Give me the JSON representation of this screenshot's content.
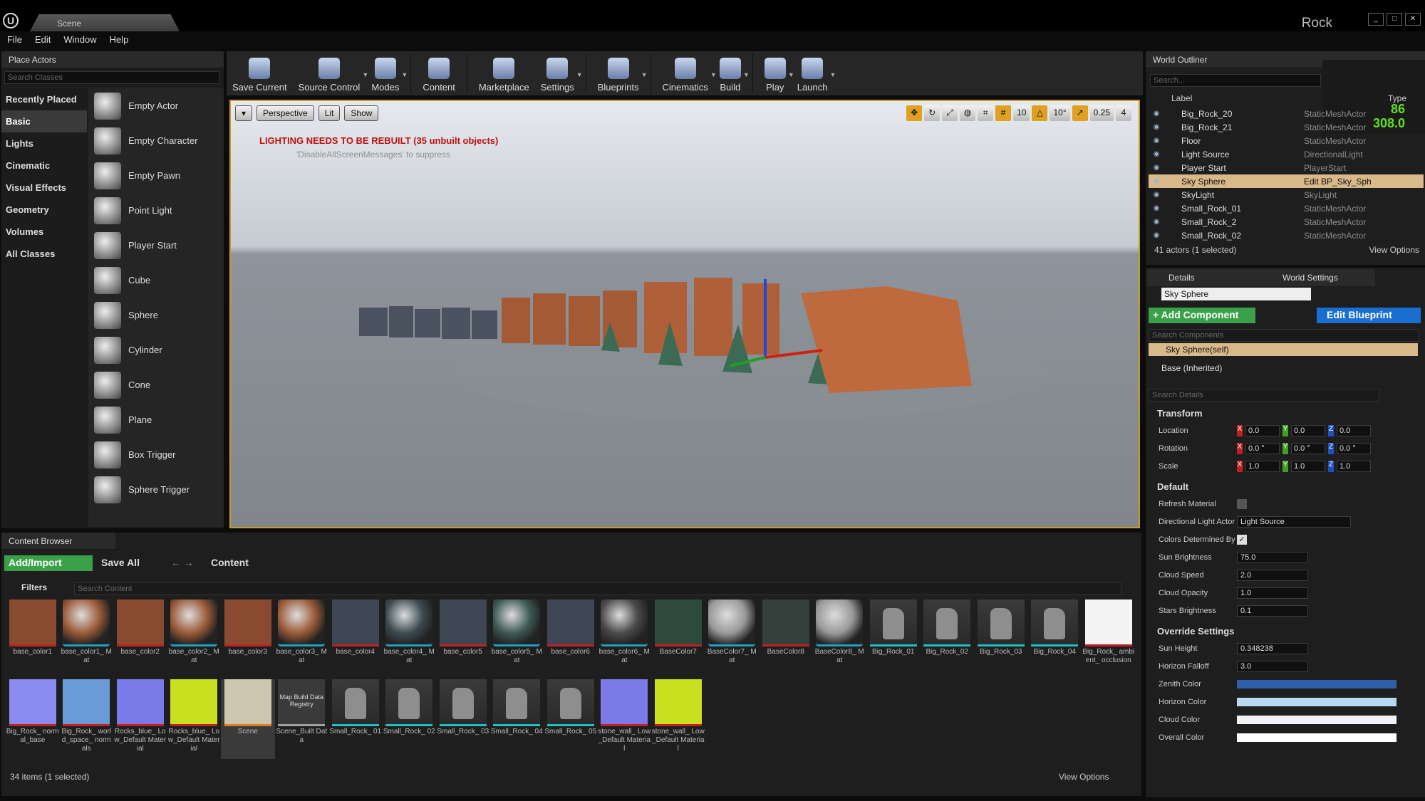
{
  "window": {
    "tab_title": "Scene",
    "project": "Rock"
  },
  "menu": [
    "File",
    "Edit",
    "Window",
    "Help"
  ],
  "place_actors": {
    "title": "Place Actors",
    "search_placeholder": "Search Classes",
    "categories": [
      "Recently Placed",
      "Basic",
      "Lights",
      "Cinematic",
      "Visual Effects",
      "Geometry",
      "Volumes",
      "All Classes"
    ],
    "selected_category": "Basic",
    "actors": [
      "Empty Actor",
      "Empty Character",
      "Empty Pawn",
      "Point Light",
      "Player Start",
      "Cube",
      "Sphere",
      "Cylinder",
      "Cone",
      "Plane",
      "Box Trigger",
      "Sphere Trigger"
    ]
  },
  "toolbar": [
    {
      "label": "Save Current",
      "dd": false
    },
    {
      "label": "Source Control",
      "dd": true
    },
    {
      "label": "Modes",
      "dd": true
    },
    {
      "label": "Content",
      "dd": false
    },
    {
      "label": "Marketplace",
      "dd": false
    },
    {
      "label": "Settings",
      "dd": true
    },
    {
      "label": "Blueprints",
      "dd": true
    },
    {
      "label": "Cinematics",
      "dd": true
    },
    {
      "label": "Build",
      "dd": true
    },
    {
      "label": "Play",
      "dd": true
    },
    {
      "label": "Launch",
      "dd": true
    }
  ],
  "viewport": {
    "view_mode": "Perspective",
    "lit": "Lit",
    "show": "Show",
    "grid": "10",
    "rot": "10°",
    "scale": "0.25",
    "cam_speed": "4",
    "warning": "LIGHTING NEEDS TO BE REBUILT (35 unbuilt objects)",
    "hint": "'DisableAllScreenMessages' to suppress"
  },
  "outliner": {
    "title": "World Outliner",
    "search_placeholder": "Search...",
    "col_label": "Label",
    "col_type": "Type",
    "stat_fps": "86",
    "stat_ms": "308.0",
    "rows": [
      {
        "label": "Big_Rock_20",
        "type": "StaticMeshActor"
      },
      {
        "label": "Big_Rock_21",
        "type": "StaticMeshActor"
      },
      {
        "label": "Floor",
        "type": "StaticMeshActor"
      },
      {
        "label": "Light Source",
        "type": "DirectionalLight"
      },
      {
        "label": "Player Start",
        "type": "PlayerStart"
      },
      {
        "label": "Sky Sphere",
        "type": "Edit BP_Sky_Sph"
      },
      {
        "label": "SkyLight",
        "type": "SkyLight"
      },
      {
        "label": "Small_Rock_01",
        "type": "StaticMeshActor"
      },
      {
        "label": "Small_Rock_2",
        "type": "StaticMeshActor"
      },
      {
        "label": "Small_Rock_02",
        "type": "StaticMeshActor"
      }
    ],
    "selected": "Sky Sphere",
    "footer": "41 actors (1 selected)",
    "view_options": "View Options"
  },
  "details": {
    "tab_details": "Details",
    "tab_world": "World Settings",
    "name": "Sky Sphere",
    "add_component": "+ Add Component",
    "edit_blueprint": "Edit Blueprint",
    "search_components": "Search Components",
    "comp_self": "Sky Sphere(self)",
    "comp_base": "Base (Inherited)",
    "search_details": "Search Details",
    "transform": "Transform",
    "location": {
      "label": "Location",
      "x": "0.0",
      "y": "0.0",
      "z": "0.0"
    },
    "rotation": {
      "label": "Rotation",
      "x": "0.0 °",
      "y": "0.0 °",
      "z": "0.0 °"
    },
    "scale": {
      "label": "Scale",
      "x": "1.0",
      "y": "1.0",
      "z": "1.0"
    },
    "default": "Default",
    "refresh_material": "Refresh Material",
    "dir_light_actor": "Directional Light Actor",
    "dir_light_value": "Light Source",
    "colors_determined": "Colors Determined By",
    "sun_brightness": {
      "label": "Sun Brightness",
      "value": "75.0"
    },
    "cloud_speed": {
      "label": "Cloud Speed",
      "value": "2.0"
    },
    "cloud_opacity": {
      "label": "Cloud Opacity",
      "value": "1.0"
    },
    "stars_brightness": {
      "label": "Stars Brightness",
      "value": "0.1"
    },
    "override": "Override Settings",
    "sun_height": {
      "label": "Sun Height",
      "value": "0.348238"
    },
    "horizon_falloff": {
      "label": "Horizon Falloff",
      "value": "3.0"
    },
    "zenith_color": {
      "label": "Zenith Color",
      "color": "#2e5fa8"
    },
    "horizon_color": {
      "label": "Horizon Color",
      "color": "#b9d8f2"
    },
    "cloud_color": {
      "label": "Cloud Color",
      "color": "#f0f2f6"
    },
    "overall_color": {
      "label": "Overall Color",
      "color": "#ffffff"
    }
  },
  "content_browser": {
    "title": "Content Browser",
    "add_import": "Add/Import",
    "save_all": "Save All",
    "path": "Content",
    "filters": "Filters",
    "search_placeholder": "Search Content",
    "assets": [
      {
        "name": "base_color1",
        "kind": "tex",
        "color": "#8a4a30"
      },
      {
        "name": "base_color1_ Mat",
        "kind": "mat",
        "color": "#9a5a38"
      },
      {
        "name": "base_color2",
        "kind": "tex",
        "color": "#8a4a30"
      },
      {
        "name": "base_color2_ Mat",
        "kind": "mat",
        "color": "#9a5a38"
      },
      {
        "name": "base_color3",
        "kind": "tex",
        "color": "#8a4a30"
      },
      {
        "name": "base_color3_ Mat",
        "kind": "mat",
        "color": "#9a5a38"
      },
      {
        "name": "base_color4",
        "kind": "tex",
        "color": "#3e4654"
      },
      {
        "name": "base_color4_ Mat",
        "kind": "mat",
        "color": "#3e4c52"
      },
      {
        "name": "base_color5",
        "kind": "tex",
        "color": "#3e4654"
      },
      {
        "name": "base_color5_ Mat",
        "kind": "mat",
        "color": "#3e5a55"
      },
      {
        "name": "base_color6",
        "kind": "tex",
        "color": "#3e4654"
      },
      {
        "name": "base_color6_ Mat",
        "kind": "mat",
        "color": "#4a4a4a"
      },
      {
        "name": "BaseColor7",
        "kind": "tex",
        "color": "#2e4a3c"
      },
      {
        "name": "BaseColor7_ Mat",
        "kind": "mat",
        "color": "#999999"
      },
      {
        "name": "BaseColor8",
        "kind": "tex",
        "color": "#34403c"
      },
      {
        "name": "BaseColor8_ Mat",
        "kind": "mat",
        "color": "#999999"
      },
      {
        "name": "Big_Rock_01",
        "kind": "mesh",
        "color": "#8e8e8e"
      },
      {
        "name": "Big_Rock_02",
        "kind": "mesh",
        "color": "#8e8e8e"
      },
      {
        "name": "Big_Rock_03",
        "kind": "mesh",
        "color": "#8e8e8e"
      },
      {
        "name": "Big_Rock_04",
        "kind": "mesh",
        "color": "#8e8e8e"
      },
      {
        "name": "Big_Rock_ ambient_ occlusion",
        "kind": "tex",
        "color": "#f4f4f4"
      },
      {
        "name": "Big_Rock_ normal_base",
        "kind": "tex",
        "color": "#8a8af0"
      },
      {
        "name": "Big_Rock_ world_space_ normals",
        "kind": "tex",
        "color": "#6a9ad8"
      },
      {
        "name": "Rocks_blue_ Low_Default Material",
        "kind": "tex",
        "color": "#7a7ae8"
      },
      {
        "name": "Rocks_blue_ Low_Default Material",
        "kind": "tex",
        "color": "#c8e020"
      },
      {
        "name": "Scene",
        "kind": "level",
        "color": "#cfc6b0"
      },
      {
        "name": "Scene_Built Data",
        "kind": "data",
        "color": "#3a3a3a"
      },
      {
        "name": "Small_Rock_ 01",
        "kind": "mesh",
        "color": "#8e8e8e"
      },
      {
        "name": "Small_Rock_ 02",
        "kind": "mesh",
        "color": "#8e8e8e"
      },
      {
        "name": "Small_Rock_ 03",
        "kind": "mesh",
        "color": "#8e8e8e"
      },
      {
        "name": "Small_Rock_ 04",
        "kind": "mesh",
        "color": "#8e8e8e"
      },
      {
        "name": "Small_Rock_ 05",
        "kind": "mesh",
        "color": "#8e8e8e"
      },
      {
        "name": "stone_wall_ Low_Default Material",
        "kind": "tex",
        "color": "#7a7ae8"
      },
      {
        "name": "stone_wall_ Low_Default Material",
        "kind": "tex",
        "color": "#c8e020"
      }
    ],
    "map_build_label": "Map Build Data Registry",
    "selected": "Scene",
    "count": "34 items (1 selected)",
    "view_options": "View Options"
  }
}
